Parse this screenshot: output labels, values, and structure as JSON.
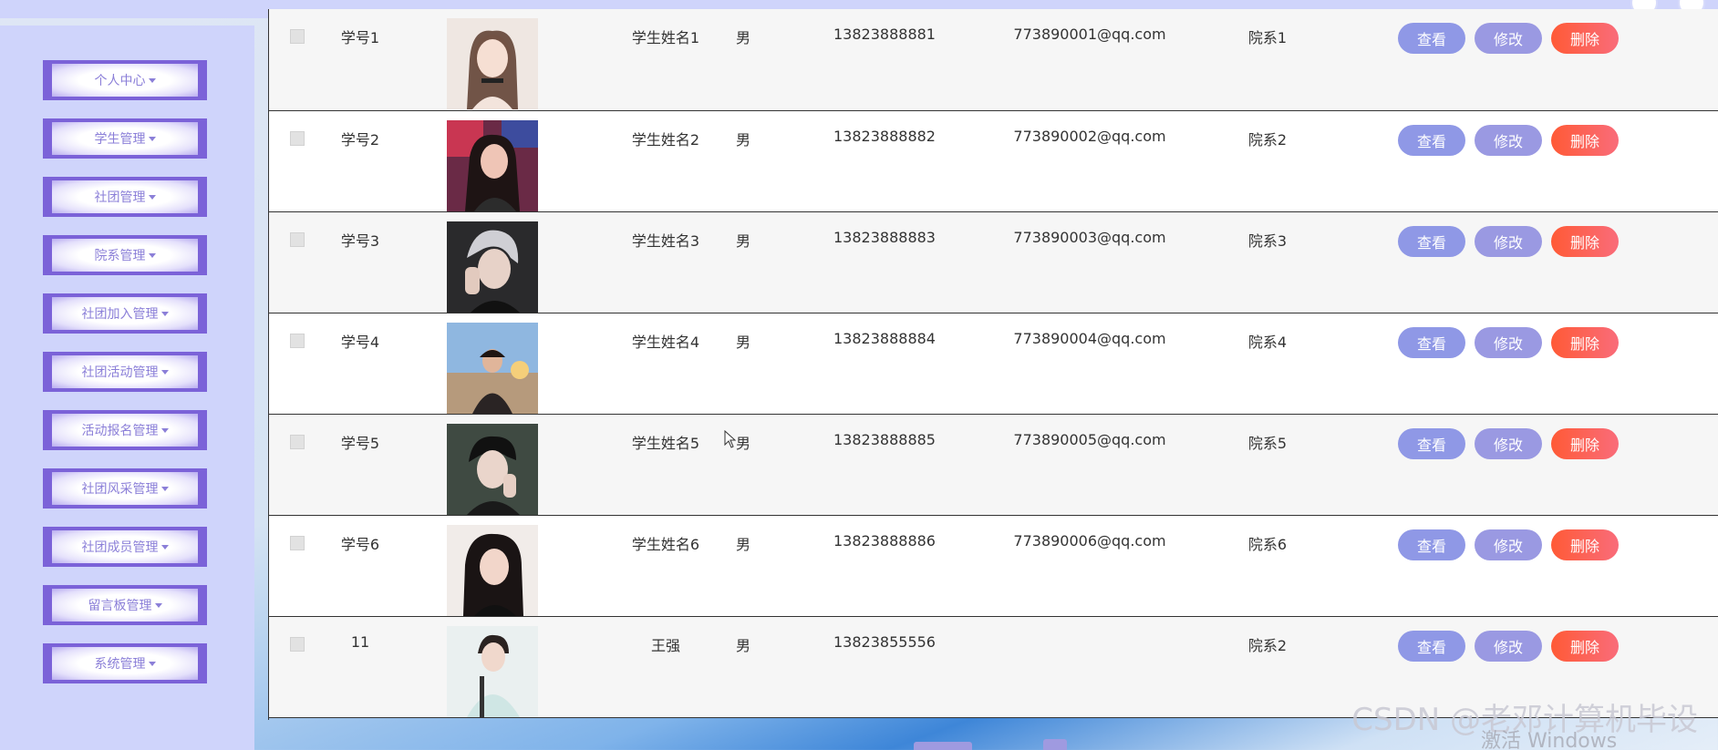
{
  "sidebar": {
    "items": [
      {
        "label": "个人中心"
      },
      {
        "label": "学生管理"
      },
      {
        "label": "社团管理"
      },
      {
        "label": "院系管理"
      },
      {
        "label": "社团加入管理"
      },
      {
        "label": "社团活动管理"
      },
      {
        "label": "活动报名管理"
      },
      {
        "label": "社团风采管理"
      },
      {
        "label": "社团成员管理"
      },
      {
        "label": "留言板管理"
      },
      {
        "label": "系统管理"
      }
    ]
  },
  "table": {
    "actions": {
      "view": "查看",
      "edit": "修改",
      "delete": "删除"
    },
    "rows": [
      {
        "id": "学号1",
        "name": "学生姓名1",
        "sex": "男",
        "phone": "13823888881",
        "email": "773890001@qq.com",
        "dept": "院系1"
      },
      {
        "id": "学号2",
        "name": "学生姓名2",
        "sex": "男",
        "phone": "13823888882",
        "email": "773890002@qq.com",
        "dept": "院系2"
      },
      {
        "id": "学号3",
        "name": "学生姓名3",
        "sex": "男",
        "phone": "13823888883",
        "email": "773890003@qq.com",
        "dept": "院系3"
      },
      {
        "id": "学号4",
        "name": "学生姓名4",
        "sex": "男",
        "phone": "13823888884",
        "email": "773890004@qq.com",
        "dept": "院系4"
      },
      {
        "id": "学号5",
        "name": "学生姓名5",
        "sex": "男",
        "phone": "13823888885",
        "email": "773890005@qq.com",
        "dept": "院系5"
      },
      {
        "id": "学号6",
        "name": "学生姓名6",
        "sex": "男",
        "phone": "13823888886",
        "email": "773890006@qq.com",
        "dept": "院系6"
      },
      {
        "id": "11",
        "name": "王强",
        "sex": "男",
        "phone": "13823855556",
        "email": "",
        "dept": "院系2"
      }
    ]
  },
  "overlay": {
    "watermark": "CSDN @老邓计算机毕设",
    "activate_windows": "激活 Windows"
  },
  "colors": {
    "sidebar_bg": "#cfd4fb",
    "menu_border": "#7b62d8",
    "btn_view": "#8f98e6",
    "btn_edit": "#9a99e2",
    "btn_delete": "#ff5a36"
  }
}
